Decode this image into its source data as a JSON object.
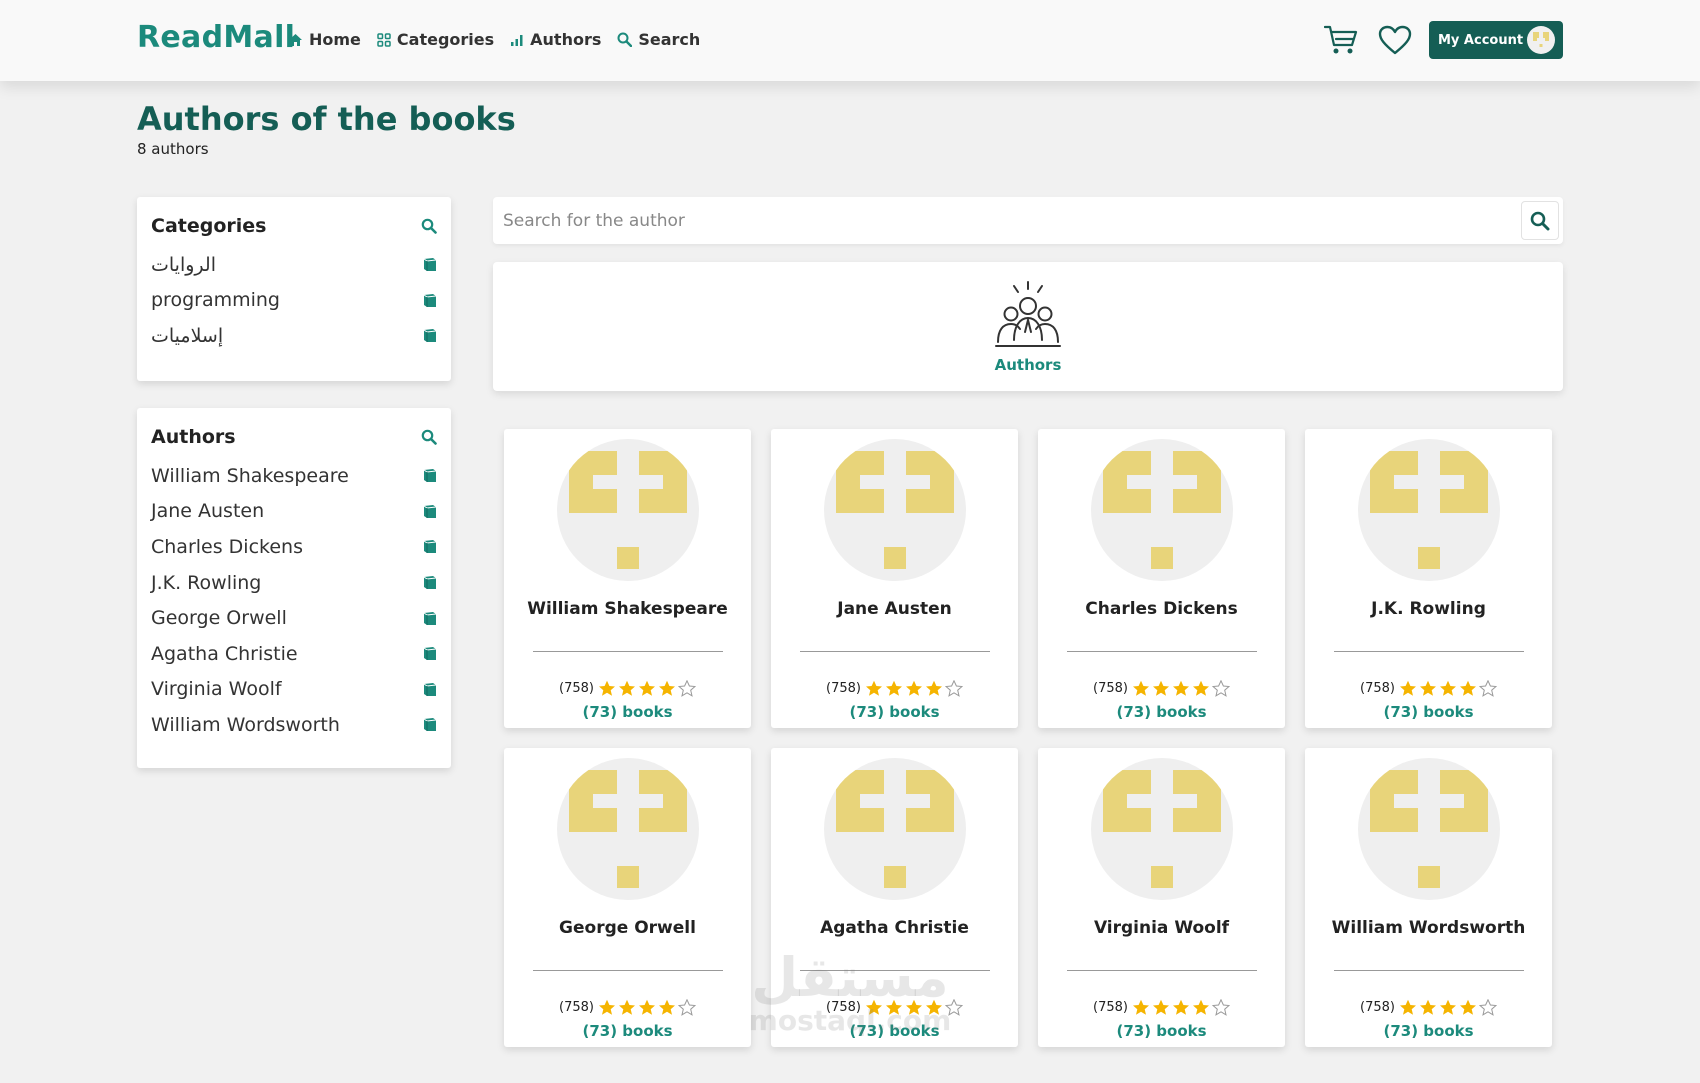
{
  "nav": {
    "brand": "ReadMall",
    "links": [
      {
        "label": "Home",
        "icon": "home-icon"
      },
      {
        "label": "Categories",
        "icon": "grid-icon"
      },
      {
        "label": "Authors",
        "icon": "chart-icon"
      },
      {
        "label": "Search",
        "icon": "search-icon"
      }
    ],
    "account_label": "My Account"
  },
  "header": {
    "title": "Authors of the books",
    "subtitle": "8 authors"
  },
  "sidebar": {
    "categories": {
      "title": "Categories",
      "items": [
        "الروايات",
        "programming",
        "إسلاميات"
      ]
    },
    "authors": {
      "title": "Authors",
      "items": [
        "William Shakespeare",
        "Jane Austen",
        "Charles Dickens",
        "J.K. Rowling",
        "George Orwell",
        "Agatha Christie",
        "Virginia Woolf",
        "William Wordsworth"
      ]
    }
  },
  "search": {
    "placeholder": "Search for the author"
  },
  "banner": {
    "label": "Authors"
  },
  "authors": [
    {
      "name": "William Shakespeare",
      "rating_count": "(758)",
      "rating": 4,
      "books": "(73) books"
    },
    {
      "name": "Jane Austen",
      "rating_count": "(758)",
      "rating": 4,
      "books": "(73) books"
    },
    {
      "name": "Charles Dickens",
      "rating_count": "(758)",
      "rating": 4,
      "books": "(73) books"
    },
    {
      "name": "J.K. Rowling",
      "rating_count": "(758)",
      "rating": 4,
      "books": "(73) books"
    },
    {
      "name": "George Orwell",
      "rating_count": "(758)",
      "rating": 4,
      "books": "(73) books"
    },
    {
      "name": "Agatha Christie",
      "rating_count": "(758)",
      "rating": 4,
      "books": "(73) books"
    },
    {
      "name": "Virginia Woolf",
      "rating_count": "(758)",
      "rating": 4,
      "books": "(73) books"
    },
    {
      "name": "William Wordsworth",
      "rating_count": "(758)",
      "rating": 4,
      "books": "(73) books"
    }
  ],
  "watermark": {
    "arabic": "مستقل",
    "latin": "mostaql.com"
  },
  "colors": {
    "brand": "#1c8a7c",
    "dark": "#155e55",
    "star": "#f5b400",
    "placeholder_art": "#e8d47a"
  }
}
